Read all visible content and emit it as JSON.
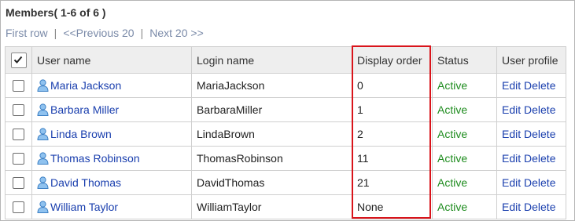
{
  "header": {
    "title": "Members( 1-6 of 6 )"
  },
  "pager": {
    "first": "First row",
    "prev": "<<Previous 20",
    "next": "Next 20 >>",
    "separator": "|"
  },
  "table": {
    "columns": {
      "user_name": "User name",
      "login_name": "Login name",
      "display_order": "Display order",
      "status": "Status",
      "user_profile": "User profile"
    },
    "edit_label": "Edit",
    "delete_label": "Delete",
    "rows": [
      {
        "user_name": "Maria Jackson",
        "login_name": "MariaJackson",
        "display_order": "0",
        "status": "Active"
      },
      {
        "user_name": "Barbara Miller",
        "login_name": "BarbaraMiller",
        "display_order": "1",
        "status": "Active"
      },
      {
        "user_name": "Linda Brown",
        "login_name": "LindaBrown",
        "display_order": "2",
        "status": "Active"
      },
      {
        "user_name": "Thomas Robinson",
        "login_name": "ThomasRobinson",
        "display_order": "11",
        "status": "Active"
      },
      {
        "user_name": "David Thomas",
        "login_name": "DavidThomas",
        "display_order": "21",
        "status": "Active"
      },
      {
        "user_name": "William Taylor",
        "login_name": "WilliamTaylor",
        "display_order": "None",
        "status": "Active"
      }
    ]
  },
  "colors": {
    "link": "#1a3fae",
    "status_active": "#1e8c1e",
    "highlight": "#d9141b",
    "header_bg": "#eeeeee"
  },
  "icons": {
    "user": "user-icon",
    "check": "checkmark-icon"
  }
}
